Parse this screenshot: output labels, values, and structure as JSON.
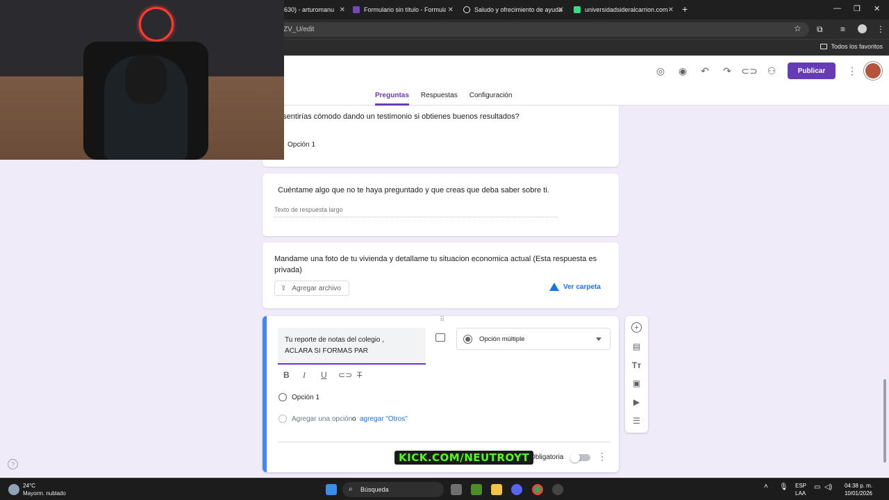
{
  "browser": {
    "tabs": [
      {
        "title": "630) - arturomanu",
        "favicon_color": "#e8eaed"
      },
      {
        "title": "Formulario sin título - Formular",
        "favicon_color": "#7248b9"
      },
      {
        "title": "Saludo y ofrecimiento de ayuda",
        "favicon_color": "#e8eaed"
      },
      {
        "title": "universidadsideralcarrion.com",
        "favicon_color": "#3ddc84"
      }
    ],
    "new_tab": "+",
    "url": "ZV_U/edit",
    "bookmarks_label": "Todos los favoritos"
  },
  "forms": {
    "publish_label": "Publicar",
    "tabs": [
      "Preguntas",
      "Respuestas",
      "Configuración"
    ],
    "accent": "#673ab7",
    "icons": [
      "palette-icon",
      "preview-icon",
      "undo-icon",
      "redo-icon",
      "link-icon",
      "add-collaborator-icon"
    ]
  },
  "questions": {
    "q1": {
      "text": "e sentirías cómodo dando un testimonio si obtienes buenos resultados?",
      "option": "Opción 1"
    },
    "q2": {
      "text": "Cuéntame algo que no te haya preguntado y que creas que deba saber sobre ti.",
      "placeholder": "Texto de respuesta largo"
    },
    "q3": {
      "text": "Mandame una foto de tu vivienda y detallame tu situacion economica actual (Esta respuesta es privada)",
      "upload_label": "Agregar archivo",
      "folder_label": "Ver carpeta"
    },
    "active": {
      "title_line1": "Tu reporte de notas del colegio ,",
      "title_line2": "ACLARA SI FORMAS PAR",
      "type": "Opción múltiple",
      "option": "Opción 1",
      "add_option": "Agregar una opción",
      "or": "o",
      "add_other": "agregar \"Otros\"",
      "required": "Obligatoria"
    }
  },
  "overlay": {
    "watermark": "KICK.COM/NEUTROYT"
  },
  "taskbar": {
    "temperature": "24°C",
    "weather": "Mayorm. nublado",
    "search": "Búsqueda",
    "lang1": "ESP",
    "lang2": "LAA",
    "time": "04:38 p. m.",
    "date": "10/01/2026"
  }
}
